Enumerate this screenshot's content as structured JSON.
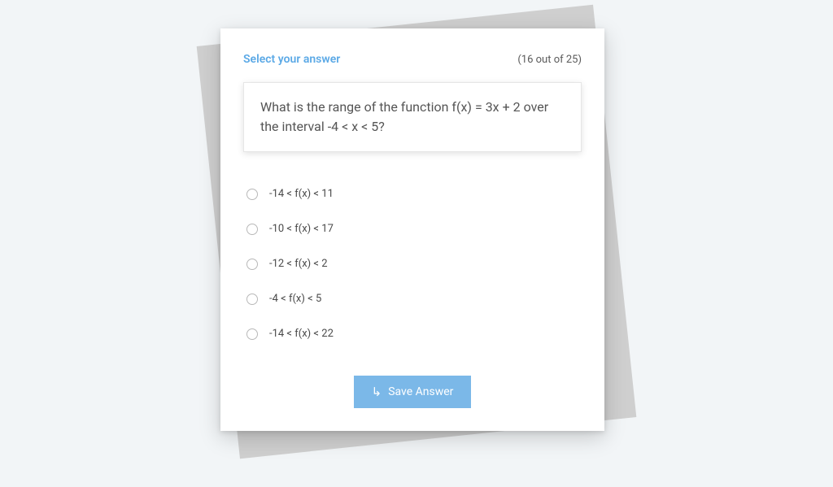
{
  "header": {
    "select_label": "Select your answer",
    "progress": "(16 out of 25)"
  },
  "question": {
    "text": "What is the range of the function f(x) = 3x + 2 over the interval -4 < x < 5?"
  },
  "options": [
    {
      "label": "-14 < f(x) < 11"
    },
    {
      "label": "-10 < f(x) < 17"
    },
    {
      "label": "-12 < f(x) < 2"
    },
    {
      "label": "-4 < f(x) < 5"
    },
    {
      "label": "-14 < f(x) < 22"
    }
  ],
  "button": {
    "save_label": "Save Answer"
  }
}
